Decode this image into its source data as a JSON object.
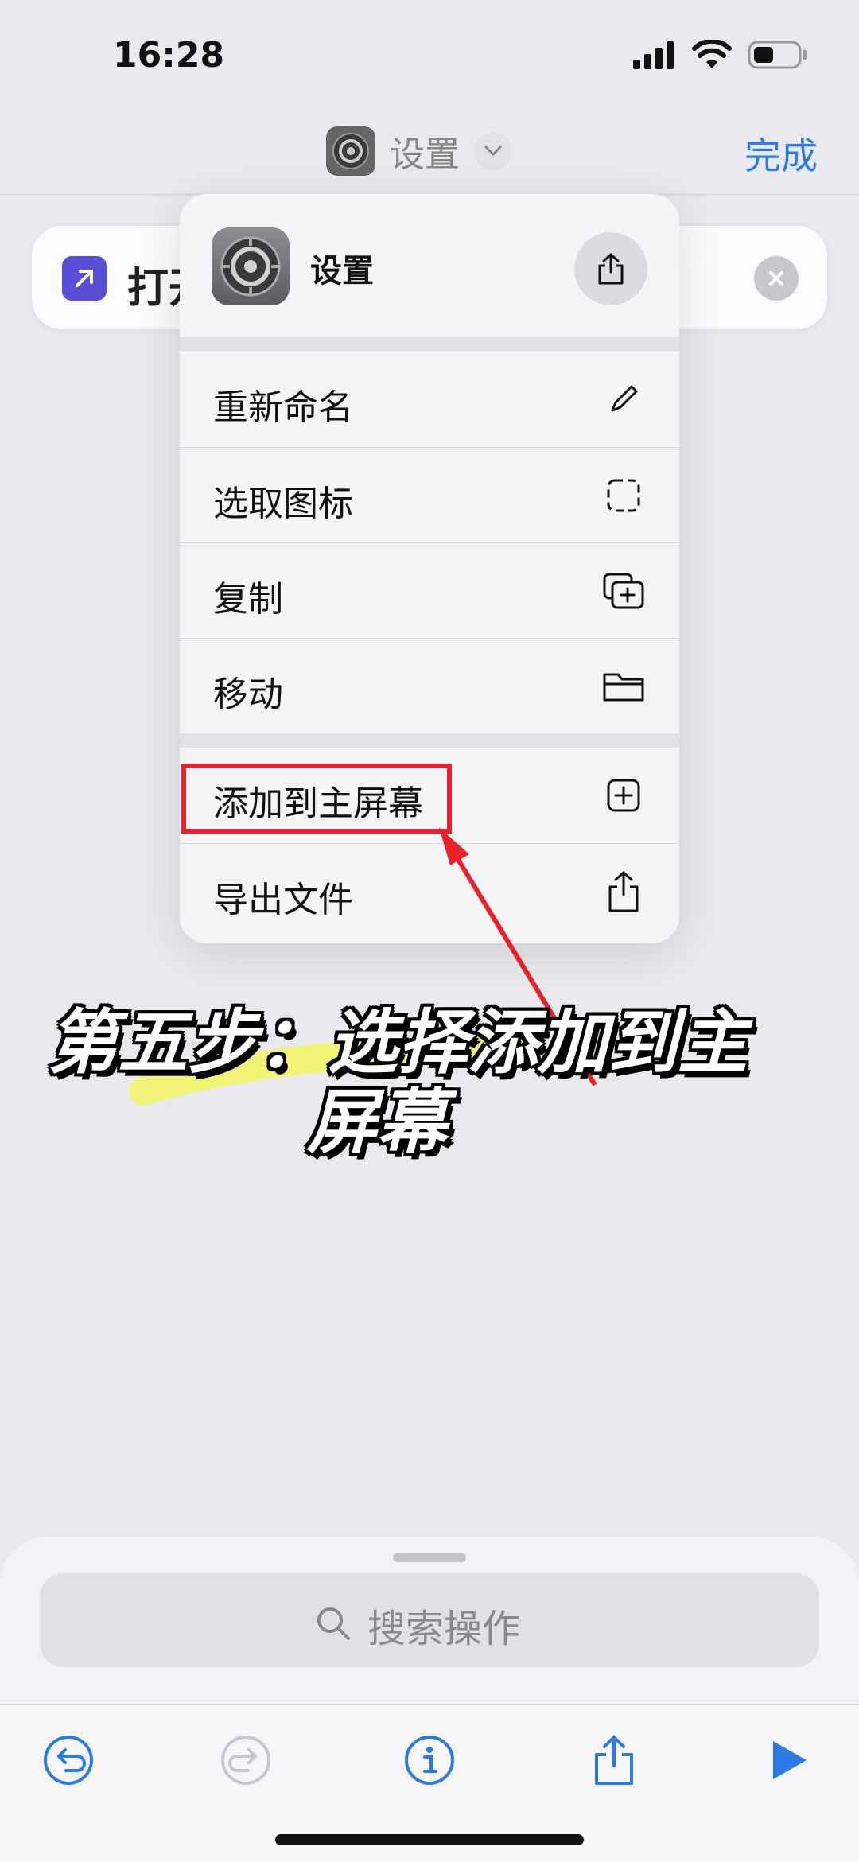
{
  "status_bar": {
    "time": "16:28"
  },
  "nav": {
    "title": "设置",
    "done": "完成"
  },
  "background_action": {
    "label": "打开"
  },
  "menu": {
    "app_name": "设置",
    "items": [
      {
        "label": "重新命名",
        "icon": "pencil-icon"
      },
      {
        "label": "选取图标",
        "icon": "dashed-square-icon"
      },
      {
        "label": "复制",
        "icon": "duplicate-icon"
      },
      {
        "label": "移动",
        "icon": "folder-icon"
      },
      {
        "label": "添加到主屏幕",
        "icon": "plus-square-icon"
      },
      {
        "label": "导出文件",
        "icon": "share-icon"
      }
    ]
  },
  "caption": {
    "line1": "第五步：选择添加到主",
    "line2": "屏幕"
  },
  "search": {
    "placeholder": "搜索操作"
  },
  "colors": {
    "accent": "#2c7be5",
    "highlight": "#e8242a",
    "marker": "#f3f56a"
  }
}
